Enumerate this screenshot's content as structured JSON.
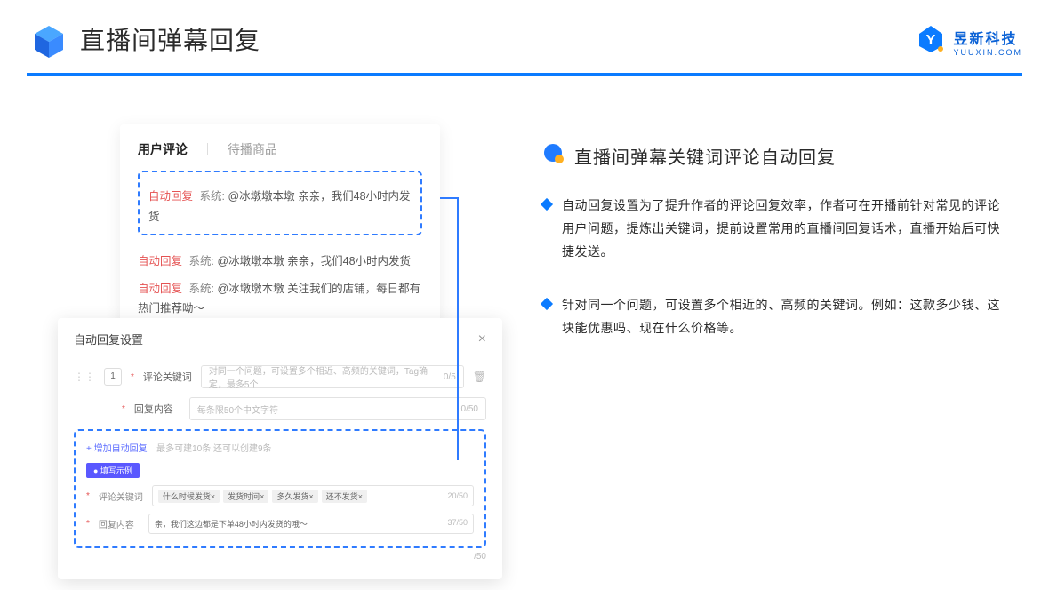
{
  "header": {
    "title": "直播间弹幕回复",
    "brand_name": "昱新科技",
    "brand_sub": "YUUXIN.COM"
  },
  "comment_card": {
    "tab_active": "用户评论",
    "tab_other": "待播商品",
    "line1_tag": "自动回复",
    "line1_sys": "系统:",
    "line1_text": "@冰墩墩本墩 亲亲，我们48小时内发货",
    "line2_tag": "自动回复",
    "line2_sys": "系统:",
    "line2_text": "@冰墩墩本墩 亲亲，我们48小时内发货",
    "line3_tag": "自动回复",
    "line3_sys": "系统:",
    "line3_text": "@冰墩墩本墩 关注我们的店铺，每日都有热门推荐呦～"
  },
  "settings": {
    "title": "自动回复设置",
    "num": "1",
    "kw_label": "评论关键词",
    "kw_placeholder": "对同一个问题，可设置多个相近、高频的关键词，Tag确定，最多5个",
    "kw_count": "0/5",
    "content_label": "回复内容",
    "content_placeholder": "每条限50个中文字符",
    "content_count": "0/50",
    "add_link": "+ 增加自动回复",
    "add_note": "最多可建10条 还可以创建9条",
    "badge": "● 填写示例",
    "ex_kw_label": "评论关键词",
    "ex_tags": [
      "什么时候发货×",
      "发货时间×",
      "多久发货×",
      "还不发货×"
    ],
    "ex_kw_count": "20/50",
    "ex_content_label": "回复内容",
    "ex_content_text": "亲，我们这边都是下单48小时内发货的哦～",
    "ex_content_count": "37/50",
    "outer_count": "/50"
  },
  "right": {
    "section_title": "直播间弹幕关键词评论自动回复",
    "bullet1": "自动回复设置为了提升作者的评论回复效率，作者可在开播前针对常见的评论用户问题，提炼出关键词，提前设置常用的直播间回复话术，直播开始后可快捷发送。",
    "bullet2": "针对同一个问题，可设置多个相近的、高频的关键词。例如：这款多少钱、这块能优惠吗、现在什么价格等。"
  }
}
